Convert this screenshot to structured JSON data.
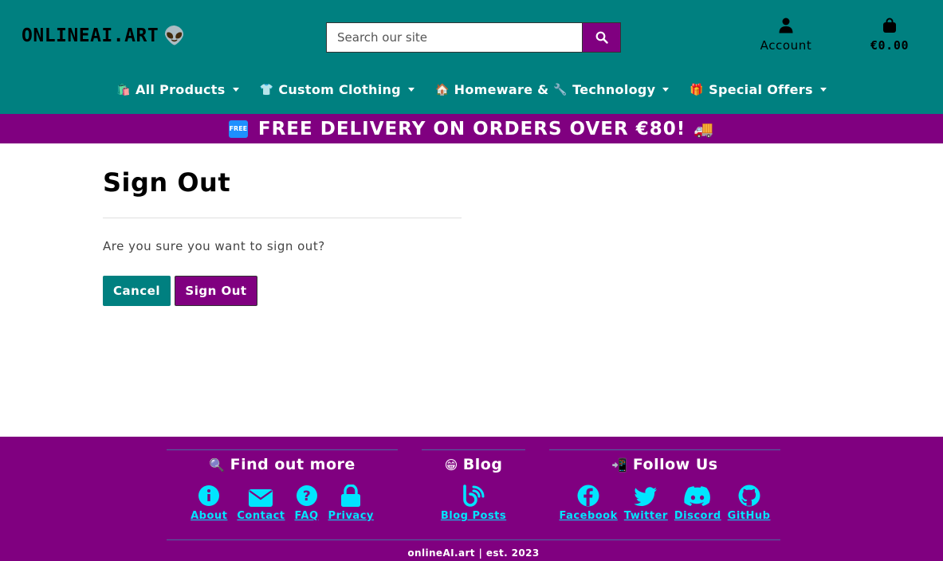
{
  "header": {
    "logo_text": "ONLINEAI.ART",
    "logo_emoji": "👽",
    "search_placeholder": "Search our site",
    "account_label": "Account",
    "cart_total": "€0.00"
  },
  "nav": {
    "items": [
      {
        "emoji": "🛍️",
        "label": "All Products"
      },
      {
        "emoji": "👕",
        "label": "Custom Clothing"
      },
      {
        "emoji": "🏠",
        "label": "Homeware &"
      },
      {
        "emoji": "🔧",
        "label": "Technology"
      },
      {
        "emoji": "🎁",
        "label": "Special Offers"
      }
    ]
  },
  "banner": {
    "badge": "FREE",
    "text": "FREE DELIVERY ON ORDERS OVER €80!",
    "emoji": "🚚"
  },
  "main": {
    "title": "Sign Out",
    "question": "Are you sure you want to sign out?",
    "cancel_label": "Cancel",
    "signout_label": "Sign Out"
  },
  "footer": {
    "find_out_more": {
      "emoji": "🔍",
      "title": "Find out more",
      "links": [
        "About",
        "Contact",
        "FAQ",
        "Privacy"
      ]
    },
    "blog": {
      "emoji": "😁",
      "title": "Blog",
      "links": [
        "Blog Posts"
      ]
    },
    "follow": {
      "emoji": "📲",
      "title": "Follow Us",
      "links": [
        "Facebook",
        "Twitter",
        "Discord",
        "GitHub"
      ]
    },
    "copyright": "onlineAI.art | est. 2023"
  },
  "icons": {
    "search": "search-icon",
    "account": "user-icon",
    "cart": "shopping-bag-icon",
    "about": "info-icon",
    "contact": "envelope-icon",
    "faq": "question-icon",
    "privacy": "lock-icon",
    "blog": "blog-icon",
    "facebook": "facebook-icon",
    "twitter": "twitter-icon",
    "discord": "discord-icon",
    "github": "github-icon"
  },
  "colors": {
    "teal": "#008080",
    "purple": "#800080",
    "cyan_link": "#00e5ff"
  }
}
